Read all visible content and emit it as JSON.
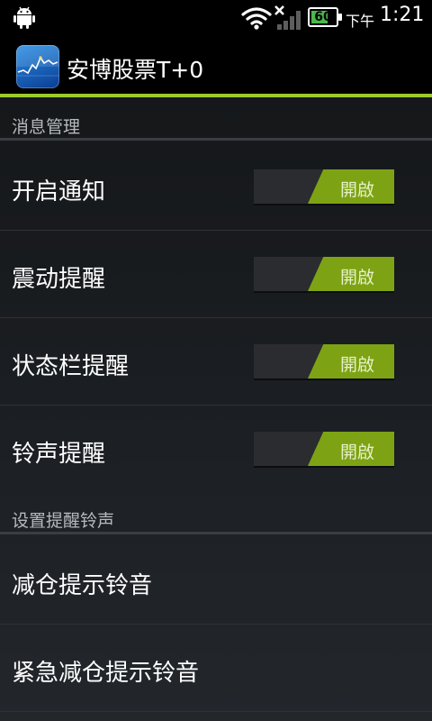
{
  "status_bar": {
    "battery_level": "60",
    "ampm": "下午",
    "time": "1:21"
  },
  "app": {
    "title": "安博股票T+0"
  },
  "sections": {
    "notifications": {
      "header": "消息管理",
      "rows": [
        {
          "label": "开启通知",
          "toggle_label": "開啟",
          "on": true
        },
        {
          "label": "震动提醒",
          "toggle_label": "開啟",
          "on": true
        },
        {
          "label": "状态栏提醒",
          "toggle_label": "開啟",
          "on": true
        },
        {
          "label": "铃声提醒",
          "toggle_label": "開啟",
          "on": true
        }
      ]
    },
    "ringtones": {
      "header": "设置提醒铃声",
      "rows": [
        {
          "label": "减仓提示铃音"
        },
        {
          "label": "紧急减仓提示铃音"
        }
      ]
    }
  },
  "colors": {
    "accent": "#9ccc2a",
    "toggle_on": "#7da314",
    "battery": "#4bb84a"
  }
}
